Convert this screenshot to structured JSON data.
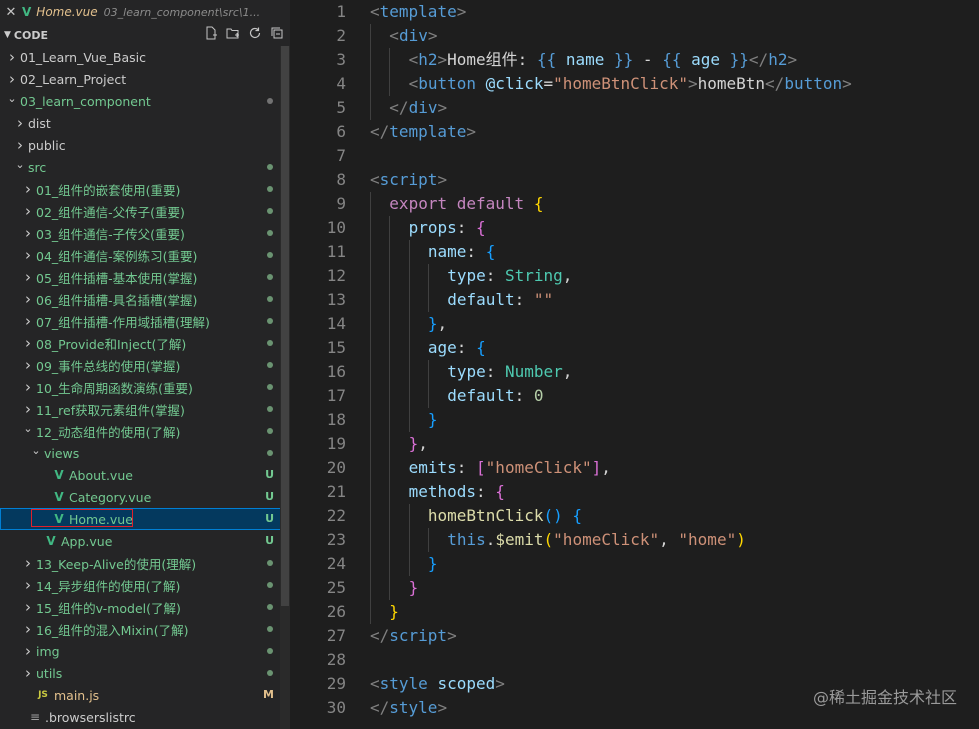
{
  "tab": {
    "close_glyph": "✕",
    "file_name": "Home.vue",
    "path": "03_learn_component\\src\\1..."
  },
  "explorer": {
    "title": "CODE",
    "action_icons": [
      "new-file-icon",
      "new-folder-icon",
      "refresh-icon",
      "collapse-all-icon"
    ]
  },
  "tree": [
    {
      "label": "01_Learn_Vue_Basic",
      "depth": 0,
      "kind": "folder",
      "open": false,
      "color": "white"
    },
    {
      "label": "02_Learn_Project",
      "depth": 0,
      "kind": "folder",
      "open": false,
      "color": "white"
    },
    {
      "label": "03_learn_component",
      "depth": 0,
      "kind": "folder",
      "open": true,
      "color": "green",
      "dot": "gray"
    },
    {
      "label": "dist",
      "depth": 1,
      "kind": "folder",
      "open": false,
      "color": "white"
    },
    {
      "label": "public",
      "depth": 1,
      "kind": "folder",
      "open": false,
      "color": "white"
    },
    {
      "label": "src",
      "depth": 1,
      "kind": "folder",
      "open": true,
      "color": "green",
      "dot": "green"
    },
    {
      "label": "01_组件的嵌套使用(重要)",
      "depth": 2,
      "kind": "folder",
      "open": false,
      "color": "green",
      "dot": "green"
    },
    {
      "label": "02_组件通信-父传子(重要)",
      "depth": 2,
      "kind": "folder",
      "open": false,
      "color": "green",
      "dot": "green"
    },
    {
      "label": "03_组件通信-子传父(重要)",
      "depth": 2,
      "kind": "folder",
      "open": false,
      "color": "green",
      "dot": "green"
    },
    {
      "label": "04_组件通信-案例练习(重要)",
      "depth": 2,
      "kind": "folder",
      "open": false,
      "color": "green",
      "dot": "green"
    },
    {
      "label": "05_组件插槽-基本使用(掌握)",
      "depth": 2,
      "kind": "folder",
      "open": false,
      "color": "green",
      "dot": "green"
    },
    {
      "label": "06_组件插槽-具名插槽(掌握)",
      "depth": 2,
      "kind": "folder",
      "open": false,
      "color": "green",
      "dot": "green"
    },
    {
      "label": "07_组件插槽-作用域插槽(理解)",
      "depth": 2,
      "kind": "folder",
      "open": false,
      "color": "green",
      "dot": "green"
    },
    {
      "label": "08_Provide和Inject(了解)",
      "depth": 2,
      "kind": "folder",
      "open": false,
      "color": "green",
      "dot": "green"
    },
    {
      "label": "09_事件总线的使用(掌握)",
      "depth": 2,
      "kind": "folder",
      "open": false,
      "color": "green",
      "dot": "green"
    },
    {
      "label": "10_生命周期函数演练(重要)",
      "depth": 2,
      "kind": "folder",
      "open": false,
      "color": "green",
      "dot": "green"
    },
    {
      "label": "11_ref获取元素组件(掌握)",
      "depth": 2,
      "kind": "folder",
      "open": false,
      "color": "green",
      "dot": "green"
    },
    {
      "label": "12_动态组件的使用(了解)",
      "depth": 2,
      "kind": "folder",
      "open": true,
      "color": "green",
      "dot": "green"
    },
    {
      "label": "views",
      "depth": 3,
      "kind": "folder",
      "open": true,
      "color": "green",
      "dot": "green"
    },
    {
      "label": "About.vue",
      "depth": 4,
      "kind": "vue",
      "color": "green",
      "badge": "U"
    },
    {
      "label": "Category.vue",
      "depth": 4,
      "kind": "vue",
      "color": "green",
      "badge": "U"
    },
    {
      "label": "Home.vue",
      "depth": 4,
      "kind": "vue",
      "color": "green",
      "badge": "U",
      "selected": true
    },
    {
      "label": "App.vue",
      "depth": 3,
      "kind": "vue",
      "color": "green",
      "badge": "U"
    },
    {
      "label": "13_Keep-Alive的使用(理解)",
      "depth": 2,
      "kind": "folder",
      "open": false,
      "color": "green",
      "dot": "green"
    },
    {
      "label": "14_异步组件的使用(了解)",
      "depth": 2,
      "kind": "folder",
      "open": false,
      "color": "green",
      "dot": "green"
    },
    {
      "label": "15_组件的v-model(了解)",
      "depth": 2,
      "kind": "folder",
      "open": false,
      "color": "green",
      "dot": "green"
    },
    {
      "label": "16_组件的混入Mixin(了解)",
      "depth": 2,
      "kind": "folder",
      "open": false,
      "color": "green",
      "dot": "green"
    },
    {
      "label": "img",
      "depth": 2,
      "kind": "folder",
      "open": false,
      "color": "green",
      "dot": "green"
    },
    {
      "label": "utils",
      "depth": 2,
      "kind": "folder",
      "open": false,
      "color": "green",
      "dot": "green"
    },
    {
      "label": "main.js",
      "depth": 2,
      "kind": "js",
      "color": "modified",
      "badge": "M"
    },
    {
      "label": ".browserslistrc",
      "depth": 1,
      "kind": "config",
      "color": "white"
    }
  ],
  "code": {
    "lines": [
      {
        "n": "1",
        "indent": 0,
        "t": [
          [
            "tag",
            "<"
          ],
          [
            "tagname",
            "template"
          ],
          [
            "tag",
            ">"
          ]
        ]
      },
      {
        "n": "2",
        "indent": 1,
        "t": [
          [
            "tag",
            "<"
          ],
          [
            "tagname",
            "div"
          ],
          [
            "tag",
            ">"
          ]
        ]
      },
      {
        "n": "3",
        "indent": 2,
        "t": [
          [
            "tag",
            "<"
          ],
          [
            "tagname",
            "h2"
          ],
          [
            "tag",
            ">"
          ],
          [
            "text",
            "Home组件: "
          ],
          [
            "interp",
            "{{"
          ],
          [
            "text",
            " "
          ],
          [
            "var",
            "name"
          ],
          [
            "text",
            " "
          ],
          [
            "interp",
            "}}"
          ],
          [
            "text",
            " - "
          ],
          [
            "interp",
            "{{"
          ],
          [
            "text",
            " "
          ],
          [
            "var",
            "age"
          ],
          [
            "text",
            " "
          ],
          [
            "interp",
            "}}"
          ],
          [
            "tag",
            "</"
          ],
          [
            "tagname",
            "h2"
          ],
          [
            "tag",
            ">"
          ]
        ]
      },
      {
        "n": "4",
        "indent": 2,
        "t": [
          [
            "tag",
            "<"
          ],
          [
            "tagname",
            "button"
          ],
          [
            "text",
            " "
          ],
          [
            "attr",
            "@click"
          ],
          [
            "text",
            "="
          ],
          [
            "str",
            "\"homeBtnClick\""
          ],
          [
            "tag",
            ">"
          ],
          [
            "text",
            "homeBtn"
          ],
          [
            "tag",
            "</"
          ],
          [
            "tagname",
            "button"
          ],
          [
            "tag",
            ">"
          ]
        ]
      },
      {
        "n": "5",
        "indent": 1,
        "t": [
          [
            "tag",
            "</"
          ],
          [
            "tagname",
            "div"
          ],
          [
            "tag",
            ">"
          ]
        ]
      },
      {
        "n": "6",
        "indent": 0,
        "t": [
          [
            "tag",
            "</"
          ],
          [
            "tagname",
            "template"
          ],
          [
            "tag",
            ">"
          ]
        ]
      },
      {
        "n": "7",
        "indent": 0,
        "t": []
      },
      {
        "n": "8",
        "indent": 0,
        "t": [
          [
            "tag",
            "<"
          ],
          [
            "tagname",
            "script"
          ],
          [
            "tag",
            ">"
          ]
        ]
      },
      {
        "n": "9",
        "indent": 1,
        "t": [
          [
            "kw",
            "export"
          ],
          [
            "text",
            " "
          ],
          [
            "kw",
            "default"
          ],
          [
            "text",
            " "
          ],
          [
            "b1",
            "{"
          ]
        ]
      },
      {
        "n": "10",
        "indent": 2,
        "t": [
          [
            "prop",
            "props"
          ],
          [
            "text",
            ": "
          ],
          [
            "b2",
            "{"
          ]
        ]
      },
      {
        "n": "11",
        "indent": 3,
        "t": [
          [
            "prop",
            "name"
          ],
          [
            "text",
            ": "
          ],
          [
            "b3",
            "{"
          ]
        ]
      },
      {
        "n": "12",
        "indent": 4,
        "t": [
          [
            "prop",
            "type"
          ],
          [
            "text",
            ": "
          ],
          [
            "type",
            "String"
          ],
          [
            "text",
            ","
          ]
        ]
      },
      {
        "n": "13",
        "indent": 4,
        "t": [
          [
            "prop",
            "default"
          ],
          [
            "text",
            ": "
          ],
          [
            "str",
            "\"\""
          ]
        ]
      },
      {
        "n": "14",
        "indent": 3,
        "t": [
          [
            "b3",
            "}"
          ],
          [
            "text",
            ","
          ]
        ]
      },
      {
        "n": "15",
        "indent": 3,
        "t": [
          [
            "prop",
            "age"
          ],
          [
            "text",
            ": "
          ],
          [
            "b3",
            "{"
          ]
        ]
      },
      {
        "n": "16",
        "indent": 4,
        "t": [
          [
            "prop",
            "type"
          ],
          [
            "text",
            ": "
          ],
          [
            "type",
            "Number"
          ],
          [
            "text",
            ","
          ]
        ]
      },
      {
        "n": "17",
        "indent": 4,
        "t": [
          [
            "prop",
            "default"
          ],
          [
            "text",
            ": "
          ],
          [
            "num",
            "0"
          ]
        ]
      },
      {
        "n": "18",
        "indent": 3,
        "t": [
          [
            "b3",
            "}"
          ]
        ]
      },
      {
        "n": "19",
        "indent": 2,
        "t": [
          [
            "b2",
            "}"
          ],
          [
            "text",
            ","
          ]
        ]
      },
      {
        "n": "20",
        "indent": 2,
        "t": [
          [
            "prop",
            "emits"
          ],
          [
            "text",
            ": "
          ],
          [
            "b2",
            "["
          ],
          [
            "str",
            "\"homeClick\""
          ],
          [
            "b2",
            "]"
          ],
          [
            "text",
            ","
          ]
        ]
      },
      {
        "n": "21",
        "indent": 2,
        "t": [
          [
            "prop",
            "methods"
          ],
          [
            "text",
            ": "
          ],
          [
            "b2",
            "{"
          ]
        ]
      },
      {
        "n": "22",
        "indent": 3,
        "t": [
          [
            "fn",
            "homeBtnClick"
          ],
          [
            "b3",
            "()"
          ],
          [
            "text",
            " "
          ],
          [
            "b3",
            "{"
          ]
        ]
      },
      {
        "n": "23",
        "indent": 4,
        "t": [
          [
            "kw2",
            "this"
          ],
          [
            "text",
            "."
          ],
          [
            "fn",
            "$emit"
          ],
          [
            "b1",
            "("
          ],
          [
            "str",
            "\"homeClick\""
          ],
          [
            "text",
            ", "
          ],
          [
            "str",
            "\"home\""
          ],
          [
            "b1",
            ")"
          ]
        ]
      },
      {
        "n": "24",
        "indent": 3,
        "t": [
          [
            "b3",
            "}"
          ]
        ]
      },
      {
        "n": "25",
        "indent": 2,
        "t": [
          [
            "b2",
            "}"
          ]
        ]
      },
      {
        "n": "26",
        "indent": 1,
        "t": [
          [
            "b1",
            "}"
          ]
        ]
      },
      {
        "n": "27",
        "indent": 0,
        "t": [
          [
            "tag",
            "</"
          ],
          [
            "tagname",
            "script"
          ],
          [
            "tag",
            ">"
          ]
        ]
      },
      {
        "n": "28",
        "indent": 0,
        "t": []
      },
      {
        "n": "29",
        "indent": 0,
        "t": [
          [
            "tag",
            "<"
          ],
          [
            "tagname",
            "style"
          ],
          [
            "text",
            " "
          ],
          [
            "attr",
            "scoped"
          ],
          [
            "tag",
            ">"
          ]
        ]
      },
      {
        "n": "30",
        "indent": 0,
        "t": [
          [
            "tag",
            "</"
          ],
          [
            "tagname",
            "style"
          ],
          [
            "tag",
            ">"
          ]
        ]
      }
    ]
  },
  "watermark": "@稀土掘金技术社区"
}
